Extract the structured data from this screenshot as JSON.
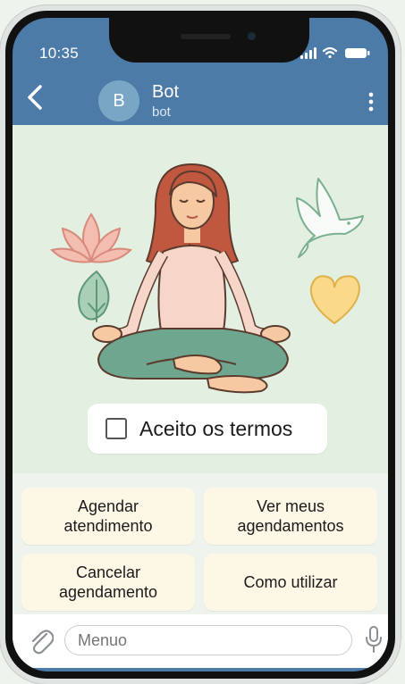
{
  "status": {
    "time": "10:35"
  },
  "chat_header": {
    "avatar_letter": "B",
    "title": "Bot",
    "subtitle": "bot"
  },
  "terms": {
    "label": "Aceito os termos",
    "checked": false
  },
  "keyboard": {
    "buttons": [
      {
        "label": "Agendar\natendimento"
      },
      {
        "label": "Ver meus\nagendamentos"
      },
      {
        "label": "Cancelar\nagendamento"
      },
      {
        "label": "Como utilizar"
      }
    ]
  },
  "composer": {
    "placeholder": "Menuo"
  },
  "colors": {
    "header": "#4d7ba8",
    "chat_bg": "#e3efe1",
    "button_bg": "#fdf7e6"
  }
}
